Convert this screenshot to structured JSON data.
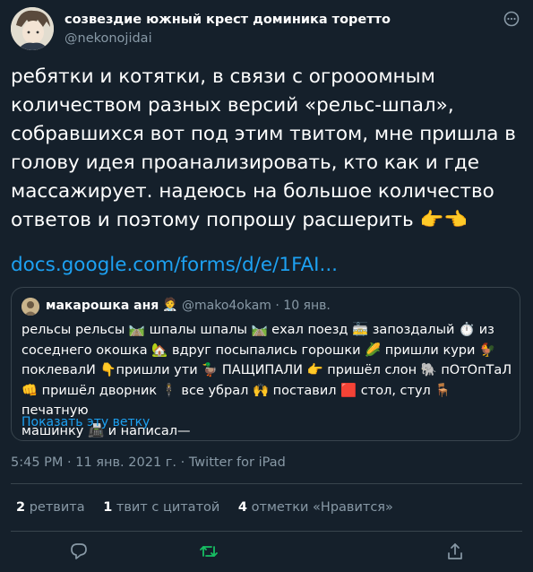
{
  "author": {
    "name": "созвездие южный крест доминика торетто",
    "handle": "@nekonojidai"
  },
  "tweet": {
    "text": "ребятки и котятки, в связи с огрооомным\nколичеством разных версий «рельс-шпал»,\nсобравшихся вот под этим твитом, мне пришла в\nголову идея проанализировать, кто как и где\nмассажирует. надеюсь на большое количество\nответов и поэтому попрошу расшерить 👉👈",
    "link": "docs.google.com/forms/d/e/1FAI..."
  },
  "quote": {
    "name": "макарошка аня",
    "name_emoji": "🧑‍⚕️",
    "handle_date": "@mako4okam · 10 янв.",
    "text": "рельсы рельсы 🛤️ шпалы шпалы 🛤️ ехал поезд 🚋 запоздалый ⏱️ из\nсоседнего окошка 🏡 вдруг посыпались горошки 🌽 пришли кури 🐓\nпоклевалИ 👇пришли ути 🦆 ПАЩИПАЛИ 👉 пришёл слон 🐘 пОтОпТаЛ\n👊 пришёл дворник 🕴️ все убрал 🙌 поставил 🟥 стол, стул 🪑 печатную\nмашинку 📠 и написал—",
    "thread_link": "Показать эту ветку"
  },
  "timestamp": "5:45 PM · 11 янв. 2021 г. · Twitter for iPad",
  "stats": {
    "retweets_count": "2",
    "retweets_label": "ретвита",
    "quotes_count": "1",
    "quotes_label": "твит с цитатой",
    "likes_count": "4",
    "likes_label": "отметки «Нравится»"
  },
  "colors": {
    "background": "#15202b",
    "accent": "#1da1f2",
    "secondary_text": "#8899a6",
    "retweet_active": "#17bf63"
  },
  "icons": [
    "more-icon",
    "reply-icon",
    "retweet-icon",
    "share-icon"
  ]
}
